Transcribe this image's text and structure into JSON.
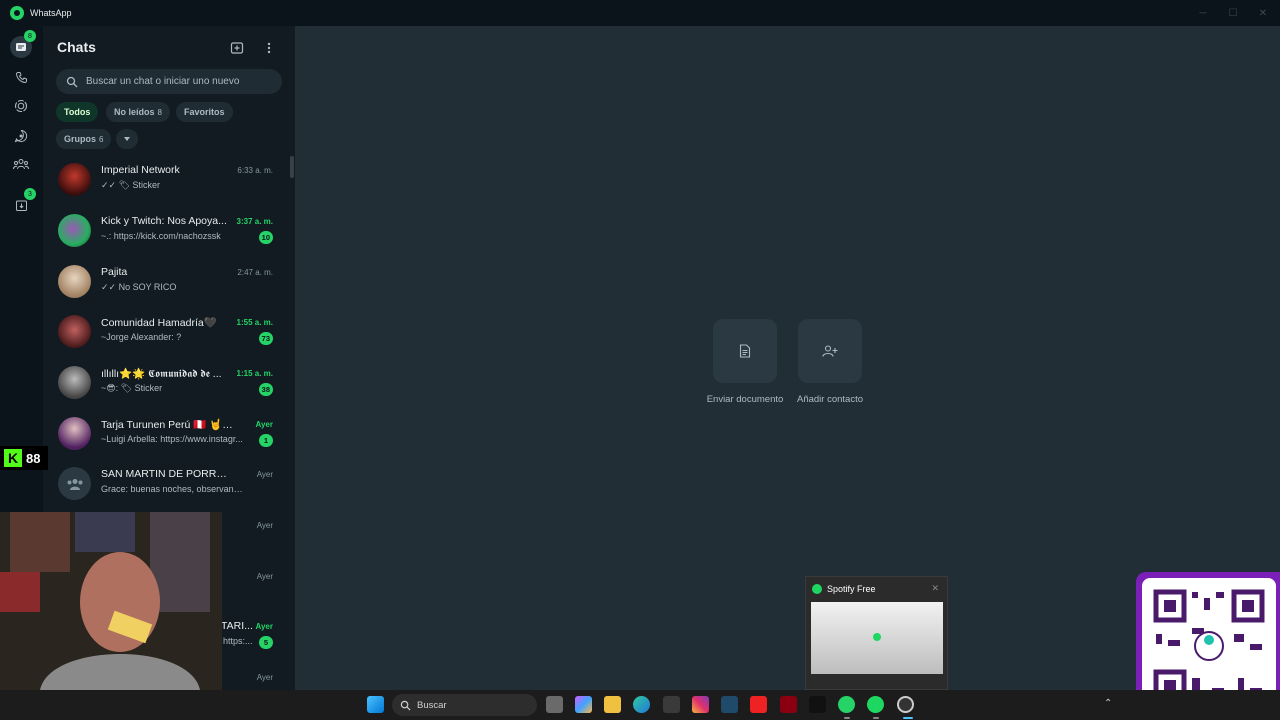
{
  "window": {
    "title": "WhatsApp"
  },
  "rail": {
    "chats_badge": "8",
    "archived_badge": "3"
  },
  "panel": {
    "title": "Chats",
    "search_placeholder": "Buscar un chat o iniciar uno nuevo",
    "filters": [
      {
        "label": "Todos",
        "count": ""
      },
      {
        "label": "No leídos",
        "count": "8"
      },
      {
        "label": "Favoritos",
        "count": ""
      },
      {
        "label": "Grupos",
        "count": "6"
      }
    ]
  },
  "chats": [
    {
      "name": "Imperial Network",
      "time": "6:33 a. m.",
      "preview": "✓✓ 🏷 Sticker",
      "badge": "",
      "unread": false
    },
    {
      "name": "Kick y Twitch: Nos Apoya...",
      "time": "3:37 a. m.",
      "preview": "~.: https://kick.com/nachozssk",
      "badge": "10",
      "unread": true
    },
    {
      "name": "Pajita",
      "time": "2:47 a. m.",
      "preview": "✓✓ No SOY RICO",
      "badge": "",
      "unread": false
    },
    {
      "name": "Comunidad Hamadría🖤",
      "time": "1:55 a. m.",
      "preview": "~Jorge Alexander: ?",
      "badge": "73",
      "unread": true
    },
    {
      "name": "ıllıllı⭐🌟 𝕮𝖔𝖒𝖚𝖓𝖎𝖉𝖆𝖉 𝖉𝖊 ...",
      "time": "1:15 a. m.",
      "preview": "~😎: 🏷 Sticker",
      "badge": "38",
      "unread": true
    },
    {
      "name": "Tarja Turunen Perú 🇵🇪 🤘 🖤",
      "time": "Ayer",
      "preview": "~Luigi Arbella: https://www.instagr...",
      "badge": "1",
      "unread": true
    },
    {
      "name": "SAN MARTIN DE PORRES III",
      "time": "Ayer",
      "preview": "Grace: buenas noches, observando qu...",
      "badge": "",
      "unread": false
    },
    {
      "name": "",
      "time": "Ayer",
      "preview": "",
      "badge": "",
      "unread": false
    },
    {
      "name": "",
      "time": "Ayer",
      "preview": "",
      "badge": "",
      "unread": false
    },
    {
      "name": "TARI...",
      "time": "Ayer",
      "preview": "https:...",
      "badge": "5",
      "unread": true
    },
    {
      "name": "",
      "time": "Ayer",
      "preview": "",
      "badge": "",
      "unread": false
    }
  ],
  "main": {
    "actions": [
      {
        "label": "Enviar documento",
        "icon": "document-icon"
      },
      {
        "label": "Añadir contacto",
        "icon": "add-contact-icon"
      }
    ]
  },
  "overlays": {
    "kick_count": "88"
  },
  "spotify_popup": {
    "title": "Spotify Free"
  },
  "taskbar": {
    "search_label": "Buscar"
  },
  "colors": {
    "accent": "#25d366",
    "background": "#111b21",
    "main_bg": "#222e35"
  }
}
